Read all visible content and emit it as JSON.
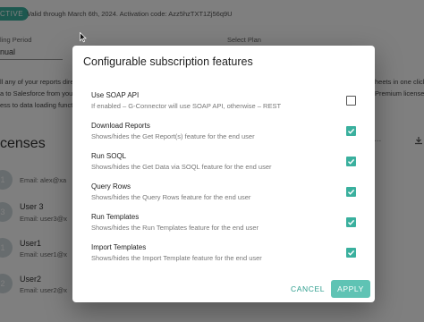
{
  "background": {
    "status_badge": "CTIVE",
    "validity_text": "Valid through March 6th, 2024. Activation code: Azz5hzTXT1Zj56q9U",
    "billing_period_label": "ling Period",
    "billing_period_value": "nual",
    "select_plan_label": "Select Plan",
    "para_left": [
      "ll any of your reports dire",
      "a to Salesforce from you",
      "ess to data loading functi"
    ],
    "para_right": [
      "heets in one click",
      "Premium license)"
    ],
    "licenses_heading": "censes",
    "dots": "...",
    "users": [
      {
        "avatar": "1",
        "name": "",
        "email": "Email: alex@xa"
      },
      {
        "avatar": "3",
        "name": "User 3",
        "email": "Email: user3@x"
      },
      {
        "avatar": "1",
        "name": "User1",
        "email": "Email: user1@x"
      },
      {
        "avatar": "2",
        "name": "User2",
        "email": "Email: user2@x"
      }
    ]
  },
  "dialog": {
    "title": "Configurable subscription features",
    "features": [
      {
        "title": "Use SOAP API",
        "description": "If enabled – G-Connector will use SOAP API, otherwise – REST",
        "checked": false
      },
      {
        "title": "Download Reports",
        "description": "Shows/hides the Get Report(s) feature for the end user",
        "checked": true
      },
      {
        "title": "Run SOQL",
        "description": "Shows/hides the Get Data via SOQL feature for the end user",
        "checked": true
      },
      {
        "title": "Query Rows",
        "description": "Shows/hides the Query Rows feature for the end user",
        "checked": true
      },
      {
        "title": "Run Templates",
        "description": "Shows/hides the Run Templates feature for the end user",
        "checked": true
      },
      {
        "title": "Import Templates",
        "description": "Shows/hides the Import Template feature for the end user",
        "checked": true
      }
    ],
    "cancel_label": "CANCEL",
    "apply_label": "APPLY"
  },
  "colors": {
    "accent": "#3ab09e",
    "apply_button": "#5fc3b4"
  }
}
